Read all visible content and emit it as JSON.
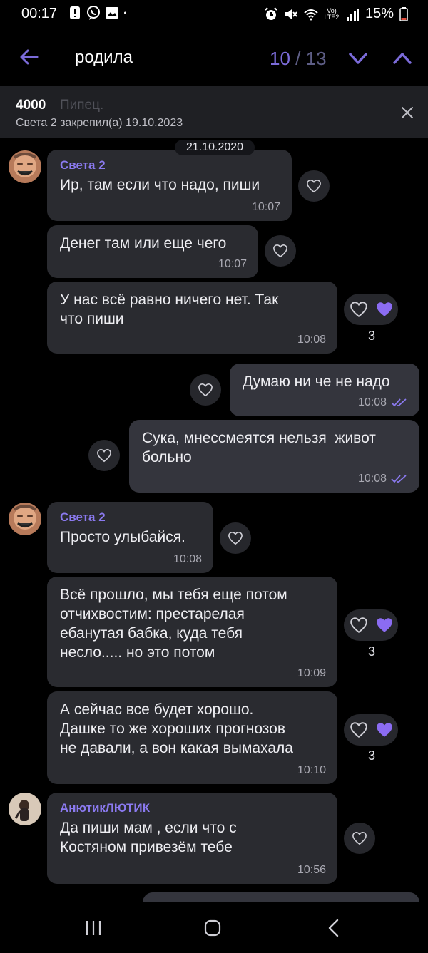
{
  "status_bar": {
    "time": "00:17",
    "battery": "15%",
    "network": "Vo) LTE2",
    "icons_left": [
      "alert-icon",
      "viber-icon",
      "gallery-icon",
      "dot-icon"
    ],
    "icons_right": [
      "alarm-icon",
      "mute-icon",
      "wifi-icon",
      "signal-icon",
      "battery-icon"
    ]
  },
  "search": {
    "query": "родила",
    "current": "10",
    "separator": "/",
    "total": "13"
  },
  "pinned": {
    "title": "4000",
    "ghost_text": "Пипец.",
    "subtitle": "Света 2 закрепил(а) 19.10.2023"
  },
  "chat": {
    "date": "21.10.2020",
    "messages": [
      {
        "sender": "Света 2",
        "text": "Ир, там если что надо, пиши",
        "time": "10:07"
      },
      {
        "text": "Денег там или еще чего",
        "time": "10:07"
      },
      {
        "text": "У нас всё равно ничего нет. Так\nчто пиши",
        "time": "10:08",
        "reactions": "3"
      },
      {
        "text": "Думаю ни че не надо",
        "time": "10:08"
      },
      {
        "text": "Сука, мнессмеятся нельзя  живот\nбольно",
        "time": "10:08"
      },
      {
        "sender": "Света 2",
        "text": "Просто улыбайся.",
        "time": "10:08"
      },
      {
        "text": "Всё прошло, мы тебя еще потом\nотчихвостим: престарелая\nебанутая бабка, куда тебя\nнесло..... но это потом",
        "time": "10:09",
        "reactions": "3"
      },
      {
        "text": "А сейчас все будет хорошо.\nДашке то же хороших прогнозов\nне давали, а вон какая вымахала",
        "time": "10:10",
        "reactions": "3"
      },
      {
        "sender": "АнютикЛЮТИК",
        "text": "Да пиши мам , если что с\nКостяном привезём тебе",
        "time": "10:56"
      }
    ]
  },
  "colors": {
    "accent": "#7b6bd9",
    "bubble_in": "#2a2b30",
    "bubble_out": "#34353d",
    "background": "#000000",
    "heart_filled": "#8b6cf2"
  }
}
